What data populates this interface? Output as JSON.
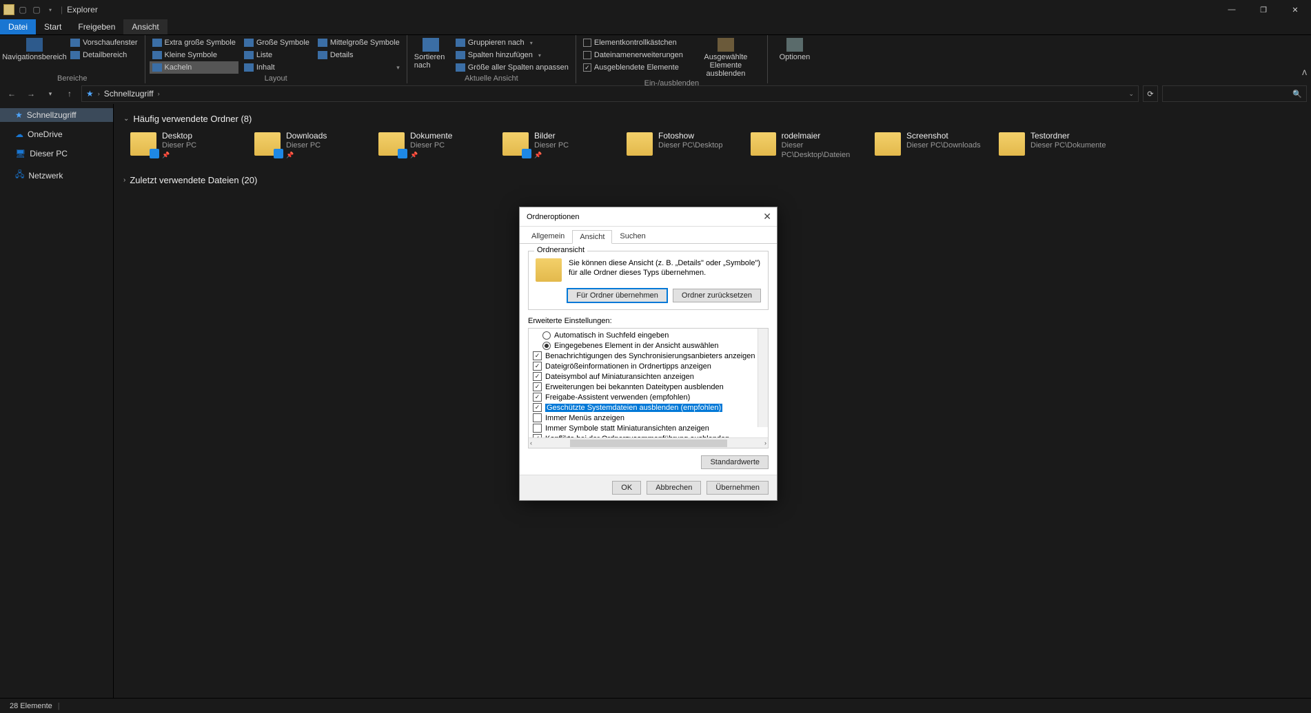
{
  "title": "Explorer",
  "tabs": {
    "file": "Datei",
    "start": "Start",
    "share": "Freigeben",
    "view": "Ansicht"
  },
  "ribbon": {
    "panes": {
      "nav_pane": "Navigationsbereich",
      "preview": "Vorschaufenster",
      "details_pane": "Detailbereich",
      "label": "Bereiche"
    },
    "layout": {
      "extra_large": "Extra große Symbole",
      "large": "Große Symbole",
      "medium": "Mittelgroße Symbole",
      "small": "Kleine Symbole",
      "list": "Liste",
      "details": "Details",
      "tiles": "Kacheln",
      "content": "Inhalt",
      "label": "Layout"
    },
    "sort": "Sortieren nach",
    "current_view": {
      "group": "Gruppieren nach",
      "add_columns": "Spalten hinzufügen",
      "autosize": "Größe aller Spalten anpassen",
      "label": "Aktuelle Ansicht"
    },
    "show_hide": {
      "item_check": "Elementkontrollkästchen",
      "file_ext": "Dateinamenerweiterungen",
      "hidden": "Ausgeblendete Elemente",
      "hide_selected": "Ausgewählte Elemente ausblenden",
      "label": "Ein-/ausblenden"
    },
    "options": "Optionen"
  },
  "breadcrumb": {
    "root": "Schnellzugriff"
  },
  "sidebar": {
    "quick": "Schnellzugriff",
    "onedrive": "OneDrive",
    "thispc": "Dieser PC",
    "network": "Netzwerk"
  },
  "sections": {
    "freq": "Häufig verwendete Ordner (8)",
    "recent": "Zuletzt verwendete Dateien (20)"
  },
  "folders": [
    {
      "name": "Desktop",
      "path": "Dieser PC",
      "pinned": true
    },
    {
      "name": "Downloads",
      "path": "Dieser PC",
      "pinned": true
    },
    {
      "name": "Dokumente",
      "path": "Dieser PC",
      "pinned": true
    },
    {
      "name": "Bilder",
      "path": "Dieser PC",
      "pinned": true
    },
    {
      "name": "Fotoshow",
      "path": "Dieser PC\\Desktop",
      "pinned": false
    },
    {
      "name": "rodelmaier",
      "path": "Dieser PC\\Desktop\\Dateien",
      "pinned": false
    },
    {
      "name": "Screenshot",
      "path": "Dieser PC\\Downloads",
      "pinned": false
    },
    {
      "name": "Testordner",
      "path": "Dieser PC\\Dokumente",
      "pinned": false
    }
  ],
  "status": "28 Elemente",
  "dialog": {
    "title": "Ordneroptionen",
    "tabs": {
      "general": "Allgemein",
      "view": "Ansicht",
      "search": "Suchen"
    },
    "group1": {
      "legend": "Ordneransicht",
      "text": "Sie können diese Ansicht (z. B. „Details\" oder „Symbole\") für alle Ordner dieses Typs übernehmen.",
      "apply": "Für Ordner übernehmen",
      "reset": "Ordner zurücksetzen"
    },
    "adv_label": "Erweiterte Einstellungen:",
    "adv": [
      {
        "t": "radio",
        "sel": false,
        "txt": "Automatisch in Suchfeld eingeben"
      },
      {
        "t": "radio",
        "sel": true,
        "txt": "Eingegebenes Element in der Ansicht auswählen"
      },
      {
        "t": "check",
        "sel": true,
        "txt": "Benachrichtigungen des Synchronisierungsanbieters anzeigen"
      },
      {
        "t": "check",
        "sel": true,
        "txt": "Dateigrößeinformationen in Ordnertipps anzeigen"
      },
      {
        "t": "check",
        "sel": true,
        "txt": "Dateisymbol auf Miniaturansichten anzeigen"
      },
      {
        "t": "check",
        "sel": true,
        "txt": "Erweiterungen bei bekannten Dateitypen ausblenden"
      },
      {
        "t": "check",
        "sel": true,
        "txt": "Freigabe-Assistent verwenden (empfohlen)"
      },
      {
        "t": "check",
        "sel": true,
        "hl": true,
        "txt": "Geschützte Systemdateien ausblenden (empfohlen)"
      },
      {
        "t": "check",
        "sel": false,
        "txt": "Immer Menüs anzeigen"
      },
      {
        "t": "check",
        "sel": false,
        "txt": "Immer Symbole statt Miniaturansichten anzeigen"
      },
      {
        "t": "check",
        "sel": true,
        "txt": "Konflikte bei der Ordnerzusammenführung ausblenden"
      }
    ],
    "defaults": "Standardwerte",
    "ok": "OK",
    "cancel": "Abbrechen",
    "apply": "Übernehmen"
  }
}
